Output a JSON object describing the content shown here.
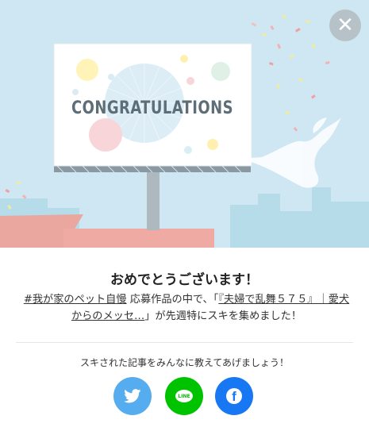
{
  "billboard": {
    "text": "CONGRATULATIONS"
  },
  "dialog": {
    "title": "おめでとうございます！",
    "tag": "#我が家のペット自慢",
    "text1": "応募作品の中で、「",
    "article": "『夫婦で乱舞５７５』｜愛犬からのメッセ…",
    "text2": "」が先週特にスキを集めました！"
  },
  "share": {
    "prompt": "スキされた記事をみんなに教えてあげましょう！",
    "buttons": [
      {
        "icon": "twitter-icon",
        "color": "#55acee"
      },
      {
        "icon": "line-icon",
        "color": "#00c300",
        "label": "LINE"
      },
      {
        "icon": "facebook-icon",
        "color": "#1877f2",
        "label": "f"
      }
    ]
  },
  "close": {
    "glyph": "✕"
  }
}
